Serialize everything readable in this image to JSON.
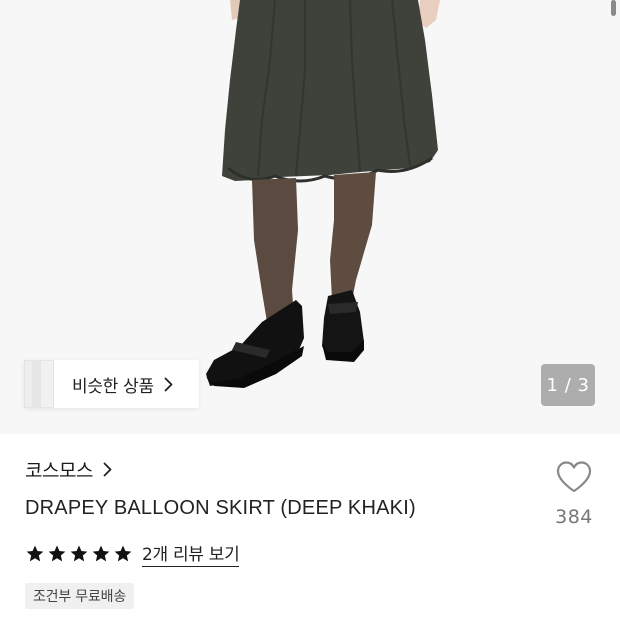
{
  "gallery": {
    "similar_products_label": "비슷한 상품",
    "page_counter": "1 / 3"
  },
  "product": {
    "brand": "코스모스",
    "title": "DRAPEY BALLOON SKIRT (DEEP KHAKI)",
    "rating_stars": 5,
    "review_link": "2개 리뷰 보기",
    "shipping_badge": "조건부 무료배송"
  },
  "like": {
    "count": "384"
  },
  "icons": {
    "similar": "chevron-right-icon",
    "brand": "chevron-right-icon",
    "like": "heart-outline-icon",
    "star": "star-filled-icon"
  },
  "colors": {
    "star": "#111111",
    "counter_bg": "#a0a0a0",
    "badge_bg": "#f0f0f0",
    "like_count": "#777777"
  }
}
